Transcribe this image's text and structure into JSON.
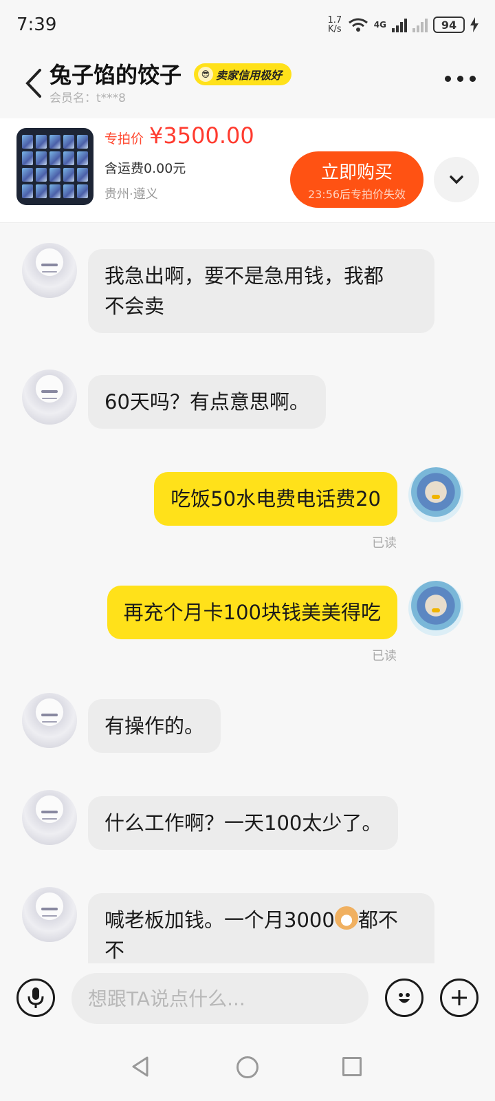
{
  "status_bar": {
    "time": "7:39",
    "net_speed_value": "1.7",
    "net_speed_unit": "K/s",
    "network": "4G",
    "battery": "94"
  },
  "header": {
    "seller_name": "兔子馅的饺子",
    "credit_badge": "卖家信用极好",
    "member_label": "会员名：",
    "member_value": "t***8"
  },
  "product": {
    "price_tag": "专拍价",
    "price": "¥3500.00",
    "shipping": "含运费0.00元",
    "location": "贵州·遵义",
    "buy_label": "立即购买",
    "buy_timer": "23:56后专拍价失效"
  },
  "messages": [
    {
      "side": "other",
      "lines": [
        "我急出啊，要不是急用钱，我都",
        "不会卖"
      ]
    },
    {
      "side": "other",
      "lines": [
        "60天吗？有点意思啊。"
      ]
    },
    {
      "side": "self",
      "lines": [
        "吃饭50水电费电话费20"
      ],
      "status": "已读"
    },
    {
      "side": "self",
      "lines": [
        "再充个月卡100块钱美美得吃"
      ],
      "status": "已读"
    },
    {
      "side": "other",
      "lines": [
        "有操作的。"
      ]
    },
    {
      "side": "other",
      "lines": [
        "什么工作啊？一天100太少了。"
      ]
    },
    {
      "side": "other",
      "lines": [
        "喊老板加钱。一个月3000",
        "都不",
        "不"
      ]
    }
  ],
  "input": {
    "placeholder": "想跟TA说点什么..."
  },
  "icons": {
    "back": "chevron-left-icon",
    "more": "more-dots-icon",
    "expand": "chevron-down-icon",
    "voice": "microphone-icon",
    "emoji": "smiley-icon",
    "plus": "plus-icon"
  },
  "colors": {
    "accent_yellow": "#ffe11a",
    "buy_orange": "#ff5213",
    "price_red": "#ff3b2f"
  }
}
